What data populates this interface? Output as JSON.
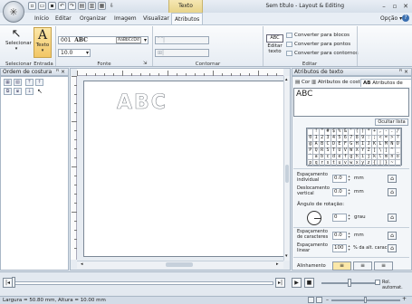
{
  "window": {
    "title": "Sem título - Layout & Editing",
    "context_tab": "Texto"
  },
  "menu": {
    "items": [
      "Início",
      "Editar",
      "Organizar",
      "Imagem",
      "Visualizar",
      "Atributos"
    ],
    "help": "Opção"
  },
  "ribbon": {
    "select_label": "Selecionar",
    "text_label": "Texto",
    "font_number": "001",
    "font_name": "ABC",
    "font_sample": "AaBbCcDd",
    "font_size": "10.0",
    "edit_text_label": "Editar\ntexto",
    "abc_icon": "ABC",
    "convert_blocks": "Converter para blocos",
    "convert_points": "Converter para pontos",
    "convert_outlines": "Converter para contornos",
    "groups": {
      "select": "Selecionar",
      "input": "Entrada",
      "font": "Fonte",
      "outline": "Contornar",
      "edit": "Editar"
    }
  },
  "left_panel": {
    "title": "Ordem de costura"
  },
  "canvas": {
    "design_text": "ABC"
  },
  "right_panel": {
    "title": "Atributos de texto",
    "tabs": [
      "Cor",
      "Atributos de cost...",
      "Atributos de texto"
    ],
    "text_value": "ABC",
    "hide_list": "Ocultar lista",
    "charmap_rows": [
      [
        "",
        "!",
        "\"",
        "#",
        "$",
        "%",
        "&",
        "'",
        "(",
        ")",
        "*",
        "+",
        ",",
        "-",
        ".",
        "/"
      ],
      [
        "0",
        "1",
        "2",
        "3",
        "4",
        "5",
        "6",
        "7",
        "8",
        "9",
        ":",
        ";",
        "<",
        "=",
        ">",
        "?"
      ],
      [
        "@",
        "A",
        "B",
        "C",
        "D",
        "E",
        "F",
        "G",
        "H",
        "I",
        "J",
        "K",
        "L",
        "M",
        "N",
        "O"
      ],
      [
        "P",
        "Q",
        "R",
        "S",
        "T",
        "U",
        "V",
        "W",
        "X",
        "Y",
        "Z",
        "[",
        "\\",
        "]",
        "^",
        "_"
      ],
      [
        "`",
        "a",
        "b",
        "c",
        "d",
        "e",
        "f",
        "g",
        "h",
        "i",
        "j",
        "k",
        "l",
        "m",
        "n",
        "o"
      ],
      [
        "p",
        "q",
        "r",
        "s",
        "t",
        "u",
        "v",
        "w",
        "x",
        "y",
        "z",
        "{",
        "|",
        "}",
        "~",
        ""
      ]
    ],
    "char_spacing_label": "Espaçamento individual",
    "char_spacing_value": "0.0",
    "vertical_offset_label": "Deslocamento vertical",
    "vertical_offset_value": "0.0",
    "unit_mm": "mm",
    "rotation_label": "Ângulo de rotação:",
    "rotation_value": "0",
    "unit_degree": "grau",
    "letter_spacing_label": "Espaçamento de caracteres",
    "letter_spacing_value": "0.0",
    "line_spacing_label": "Espaçamento linear",
    "line_spacing_value": "100",
    "line_spacing_unit": "% da alt. carac.",
    "alignment_label": "Alinhamento"
  },
  "playback": {
    "autoroll_label": "Rol. automat."
  },
  "status": {
    "text": "Largura = 50.80 mm, Altura = 10.00 mm"
  }
}
